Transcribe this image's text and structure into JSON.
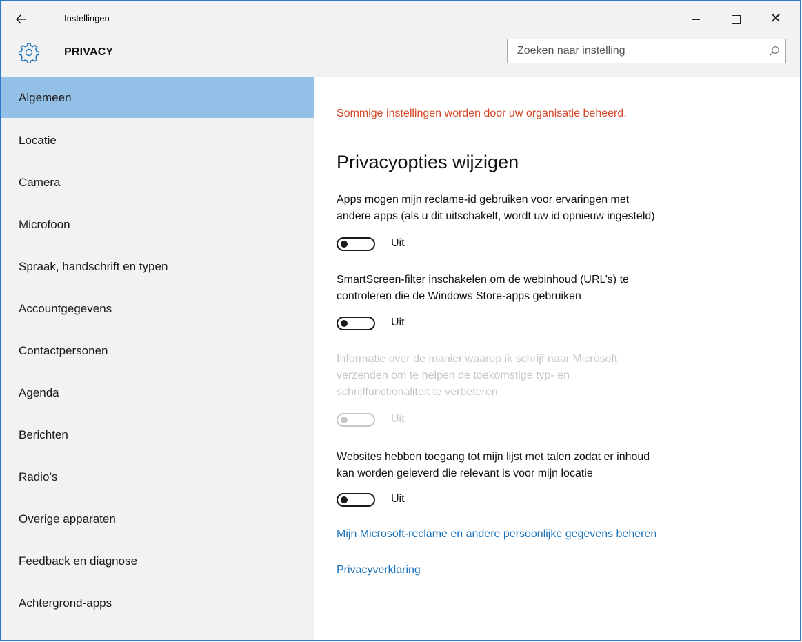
{
  "window": {
    "title": "Instellingen",
    "back_icon": "arrow-left-icon",
    "close_glyph": "✕"
  },
  "header": {
    "icon": "gear-icon",
    "title": "PRIVACY",
    "search_placeholder": "Zoeken naar instelling"
  },
  "sidebar": {
    "selected_color": "#94bfe7",
    "items": [
      {
        "label": "Algemeen",
        "selected": true
      },
      {
        "label": "Locatie"
      },
      {
        "label": "Camera"
      },
      {
        "label": "Microfoon"
      },
      {
        "label": "Spraak, handschrift en typen"
      },
      {
        "label": "Accountgegevens"
      },
      {
        "label": "Contactpersonen"
      },
      {
        "label": "Agenda"
      },
      {
        "label": "Berichten"
      },
      {
        "label": "Radio’s"
      },
      {
        "label": "Overige apparaten"
      },
      {
        "label": "Feedback en diagnose"
      },
      {
        "label": "Achtergrond-apps"
      }
    ]
  },
  "main": {
    "org_warning": "Sommige instellingen worden door uw organisatie beheerd.",
    "org_warning_color": "#d24726",
    "section_title": "Privacyopties wijzigen",
    "options": [
      {
        "line1": "Apps mogen mijn reclame-id gebruiken voor ervaringen met",
        "line2": "andere apps (als u dit uitschakelt, wordt uw id opnieuw ingesteld)",
        "state": "Uit",
        "enabled": true
      },
      {
        "line1": "SmartScreen-filter inschakelen om de webinhoud (URL’s) te",
        "line2": "controleren die de Windows Store-apps gebruiken",
        "state": "Uit",
        "enabled": true
      },
      {
        "line1": "Informatie over de manier waarop ik schrijf naar Microsoft",
        "line2": "verzenden om te helpen de toekomstige typ- en",
        "line3": "schrijffunctionaliteit te verbeteren",
        "state": "Uit",
        "enabled": false
      },
      {
        "line1": "Websites hebben toegang tot mijn lijst met talen zodat er inhoud",
        "line2": "kan worden geleverd die relevant is voor mijn locatie",
        "state": "Uit",
        "enabled": true
      }
    ],
    "links": {
      "manage_ads": "Mijn Microsoft-reclame en andere persoonlijke gegevens beheren",
      "privacy_statement": "Privacyverklaring"
    },
    "link_color": "#1a73ba"
  }
}
